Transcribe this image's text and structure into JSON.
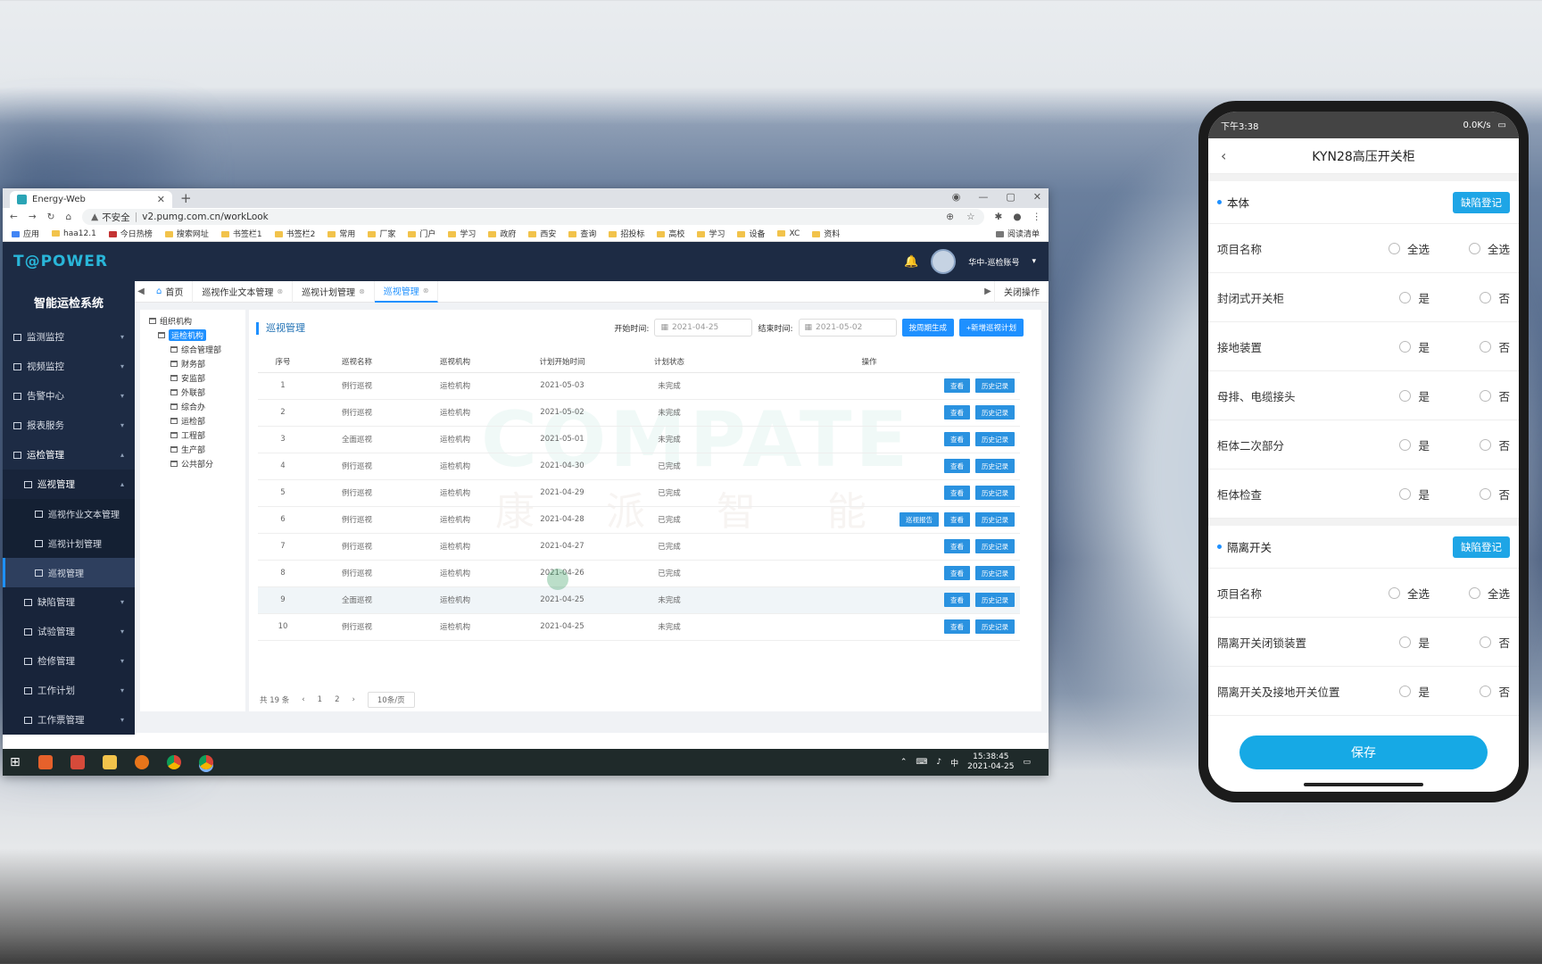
{
  "browser": {
    "tab_title": "Energy-Web",
    "address_warning": "不安全",
    "url": "v2.pumg.com.cn/workLook",
    "bookmarks": [
      "应用",
      "haa12.1",
      "今日热榜",
      "搜索网址",
      "书签栏1",
      "书签栏2",
      "常用",
      "厂家",
      "门户",
      "学习",
      "政府",
      "西安",
      "查询",
      "招投标",
      "高校",
      "学习",
      "设备",
      "XC",
      "资料"
    ],
    "bookmarks_right": "阅读清单"
  },
  "app": {
    "logo": "T@POWER",
    "system_title": "智能运检系统",
    "user": "华中-巡检账号",
    "sidebar": [
      {
        "label": "监测监控",
        "level": 0
      },
      {
        "label": "视频监控",
        "level": 0
      },
      {
        "label": "告警中心",
        "level": 0
      },
      {
        "label": "报表服务",
        "level": 0
      },
      {
        "label": "运检管理",
        "level": 0
      },
      {
        "label": "巡视管理",
        "level": 1
      },
      {
        "label": "巡视作业文本管理",
        "level": 2
      },
      {
        "label": "巡视计划管理",
        "level": 2
      },
      {
        "label": "巡视管理",
        "level": 2
      },
      {
        "label": "缺陷管理",
        "level": 1
      },
      {
        "label": "试验管理",
        "level": 1
      },
      {
        "label": "检修管理",
        "level": 1
      },
      {
        "label": "工作计划",
        "level": 1
      },
      {
        "label": "工作票管理",
        "level": 1
      }
    ],
    "page_tabs": [
      "首页",
      "巡视作业文本管理",
      "巡视计划管理",
      "巡视管理"
    ],
    "close_ops": "关闭操作",
    "tree": [
      {
        "label": "组织机构",
        "level": 0
      },
      {
        "label": "运检机构",
        "level": 1
      },
      {
        "label": "综合管理部",
        "level": 2
      },
      {
        "label": "财务部",
        "level": 2
      },
      {
        "label": "安监部",
        "level": 2
      },
      {
        "label": "外联部",
        "level": 2
      },
      {
        "label": "综合办",
        "level": 2
      },
      {
        "label": "运检部",
        "level": 2
      },
      {
        "label": "工程部",
        "level": 2
      },
      {
        "label": "生产部",
        "level": 2
      },
      {
        "label": "公共部分",
        "level": 2
      }
    ],
    "content_title": "巡视管理",
    "filter_start_label": "开始时间:",
    "filter_start_value": "2021-04-25",
    "filter_end_label": "结束时间:",
    "filter_end_value": "2021-05-02",
    "btn_generate": "按周期生成",
    "btn_add": "+新增巡视计划",
    "table_headers": [
      "序号",
      "巡视名称",
      "巡视机构",
      "计划开始时间",
      "计划状态",
      "操作"
    ],
    "rows": [
      {
        "no": "1",
        "name": "例行巡视",
        "org": "运检机构",
        "date": "2021-05-03",
        "status": "未完成",
        "ops": [
          "查看",
          "历史记录"
        ]
      },
      {
        "no": "2",
        "name": "例行巡视",
        "org": "运检机构",
        "date": "2021-05-02",
        "status": "未完成",
        "ops": [
          "查看",
          "历史记录"
        ]
      },
      {
        "no": "3",
        "name": "全面巡视",
        "org": "运检机构",
        "date": "2021-05-01",
        "status": "未完成",
        "ops": [
          "查看",
          "历史记录"
        ]
      },
      {
        "no": "4",
        "name": "例行巡视",
        "org": "运检机构",
        "date": "2021-04-30",
        "status": "已完成",
        "ops": [
          "查看",
          "历史记录"
        ]
      },
      {
        "no": "5",
        "name": "例行巡视",
        "org": "运检机构",
        "date": "2021-04-29",
        "status": "已完成",
        "ops": [
          "查看",
          "历史记录"
        ]
      },
      {
        "no": "6",
        "name": "例行巡视",
        "org": "运检机构",
        "date": "2021-04-28",
        "status": "已完成",
        "ops": [
          "巡视报告",
          "查看",
          "历史记录"
        ]
      },
      {
        "no": "7",
        "name": "例行巡视",
        "org": "运检机构",
        "date": "2021-04-27",
        "status": "已完成",
        "ops": [
          "查看",
          "历史记录"
        ]
      },
      {
        "no": "8",
        "name": "例行巡视",
        "org": "运检机构",
        "date": "2021-04-26",
        "status": "已完成",
        "ops": [
          "查看",
          "历史记录"
        ]
      },
      {
        "no": "9",
        "name": "全面巡视",
        "org": "运检机构",
        "date": "2021-04-25",
        "status": "未完成",
        "ops": [
          "查看",
          "历史记录"
        ]
      },
      {
        "no": "10",
        "name": "例行巡视",
        "org": "运检机构",
        "date": "2021-04-25",
        "status": "未完成",
        "ops": [
          "查看",
          "历史记录"
        ]
      }
    ],
    "pager_total": "共 19 条",
    "pager_pages": [
      "1",
      "2"
    ],
    "pager_size": "10条/页",
    "watermark": "COMPATE",
    "watermark_cn": "康派智能"
  },
  "taskbar": {
    "time": "15:38:45",
    "date": "2021-04-25",
    "ime": "中"
  },
  "phone": {
    "status_time": "下午3:38",
    "status_right": "0.0K/s",
    "title": "KYN28高压开关柜",
    "sections": [
      {
        "name": "本体",
        "defect_label": "缺陷登记",
        "rows": [
          {
            "label": "项目名称",
            "a": "全选",
            "b": "全选"
          },
          {
            "label": "封闭式开关柜",
            "a": "是",
            "b": "否"
          },
          {
            "label": "接地装置",
            "a": "是",
            "b": "否"
          },
          {
            "label": "母排、电缆接头",
            "a": "是",
            "b": "否"
          },
          {
            "label": "柜体二次部分",
            "a": "是",
            "b": "否"
          },
          {
            "label": "柜体检查",
            "a": "是",
            "b": "否"
          }
        ]
      },
      {
        "name": "隔离开关",
        "defect_label": "缺陷登记",
        "rows": [
          {
            "label": "项目名称",
            "a": "全选",
            "b": "全选"
          },
          {
            "label": "隔离开关闭锁装置",
            "a": "是",
            "b": "否"
          },
          {
            "label": "隔离开关及接地开关位置",
            "a": "是",
            "b": "否"
          }
        ]
      }
    ],
    "save_label": "保存"
  }
}
